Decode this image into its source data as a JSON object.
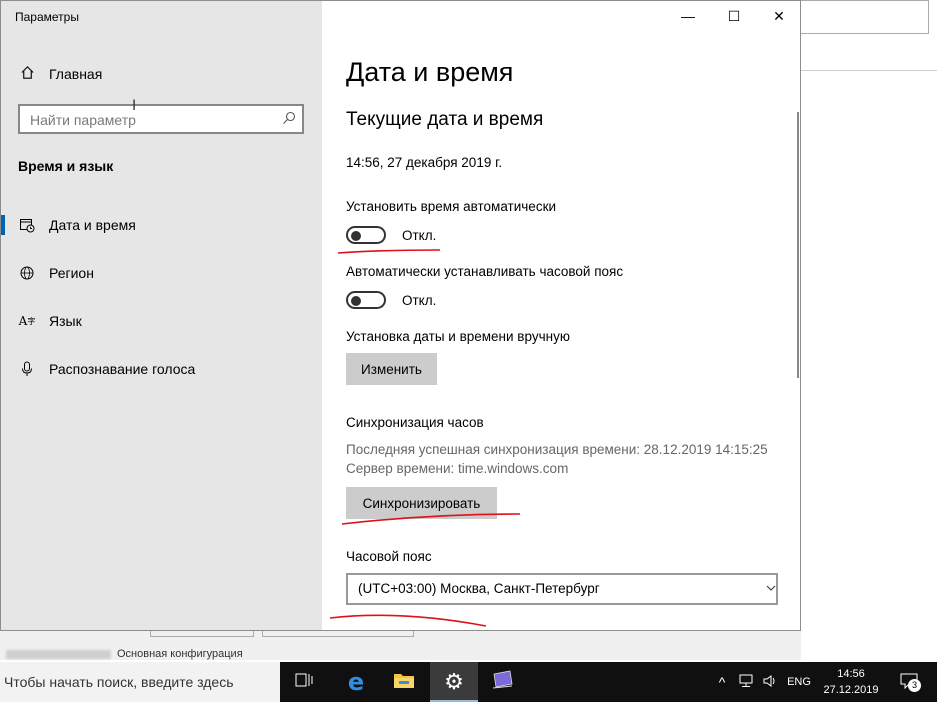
{
  "window": {
    "app_title": "Параметры",
    "controls": {
      "minimize": "—",
      "maximize": "☐",
      "close": "✕"
    }
  },
  "sidebar": {
    "home_label": "Главная",
    "search_placeholder": "Найти параметр",
    "section_label": "Время и язык",
    "items": [
      {
        "label": "Дата и время",
        "icon": "calendar-clock-icon",
        "selected": true
      },
      {
        "label": "Регион",
        "icon": "globe-icon",
        "selected": false
      },
      {
        "label": "Язык",
        "icon": "language-icon",
        "selected": false
      },
      {
        "label": "Распознавание голоса",
        "icon": "microphone-icon",
        "selected": false
      }
    ]
  },
  "main": {
    "page_title": "Дата и время",
    "section_title": "Текущие дата и время",
    "current_datetime": "14:56, 27 декабря 2019 г.",
    "auto_time": {
      "label": "Установить время автоматически",
      "state_label": "Откл.",
      "on": false
    },
    "auto_timezone": {
      "label": "Автоматически устанавливать часовой пояс",
      "state_label": "Откл.",
      "on": false
    },
    "manual": {
      "label": "Установка даты и времени вручную",
      "button": "Изменить"
    },
    "sync": {
      "title": "Синхронизация часов",
      "last_sync": "Последняя успешная синхронизация времени: 28.12.2019 14:15:25",
      "server": "Сервер времени: time.windows.com",
      "button": "Синхронизировать"
    },
    "timezone": {
      "label": "Часовой пояс",
      "value": "(UTC+03:00) Москва, Санкт-Петербург"
    }
  },
  "background": {
    "status_text": "Основная конфигурация"
  },
  "taskbar": {
    "search_placeholder": "Чтобы начать поиск, введите здесь",
    "language": "ENG",
    "time": "14:56",
    "date": "27.12.2019",
    "notification_count": "3"
  },
  "colors": {
    "accent": "#0063b1",
    "annotation": "#e0101a",
    "taskbar": "#101010"
  }
}
